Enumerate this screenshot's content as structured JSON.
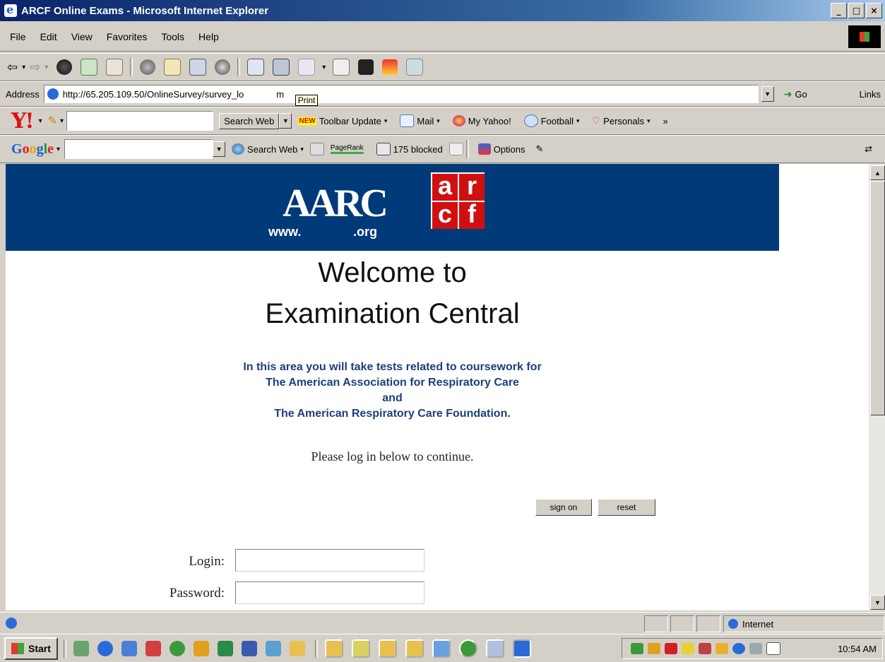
{
  "window": {
    "title": "ARCF Online Exams - Microsoft Internet Explorer"
  },
  "menu": [
    "File",
    "Edit",
    "View",
    "Favorites",
    "Tools",
    "Help"
  ],
  "address": {
    "label": "Address",
    "url": "http://65.205.109.50/OnlineSurvey/survey_lo",
    "url_tail": "m",
    "tooltip": "Print",
    "go": "Go",
    "links": "Links"
  },
  "yahoo_toolbar": {
    "search_button": "Search Web",
    "new_badge": "NEW",
    "items": [
      "Toolbar Update",
      "Mail",
      "My Yahoo!",
      "Football",
      "Personals"
    ],
    "more": "»"
  },
  "google_toolbar": {
    "logo": "Google",
    "search_button": "Search Web",
    "pagerank": "PageRank",
    "blocked": "175 blocked",
    "options": "Options"
  },
  "page": {
    "welcome_line1": "Welcome to",
    "welcome_line2": "Examination Central",
    "intro": [
      "In this area you will take tests related to coursework for",
      "The American Association for Respiratory Care",
      "and",
      "The American Respiratory Care Foundation."
    ],
    "please": "Please log in below to continue.",
    "sign_on": "sign on",
    "reset": "reset",
    "login_label": "Login:",
    "password_label": "Password:",
    "login_value": "",
    "password_value": ""
  },
  "logos": {
    "aarc_main": "AARC",
    "aarc_www": "www.",
    "aarc_org": ".org",
    "arcf": [
      "a",
      "r",
      "c",
      "f"
    ]
  },
  "status": {
    "zone": "Internet"
  },
  "taskbar": {
    "start": "Start",
    "clock": "10:54 AM"
  },
  "colors": {
    "banner": "#003a78",
    "intro_text": "#1e3f7a",
    "titlebar": "#0a246a"
  }
}
